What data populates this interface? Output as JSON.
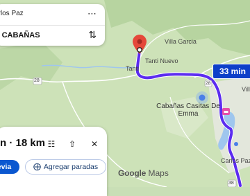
{
  "map": {
    "places": {
      "villa_garcia": "Villa Garcia",
      "tanti_nuevo": "Tanti Nuevo",
      "tanti": "Tanti",
      "cabanas_line1": "Cabañas Casitas De",
      "cabanas_line2": "Emma",
      "villa": "Villa",
      "carlos_paz": "Carlos Paz"
    },
    "route_shields": {
      "r28": "28",
      "r28_right": "28",
      "r38": "38"
    },
    "route_badge": "33 min",
    "route_color": "#5c2cf0",
    "attribution_brand": "Google",
    "attribution_product": "Maps"
  },
  "top_card": {
    "origin_label": "arlos Paz",
    "destination_label": "A CABAÑAS",
    "more_icon": "more-vert-icon",
    "swap_icon": "swap-vert-icon"
  },
  "bottom_card": {
    "eta_text": "n · 18 km",
    "preview_button": "evia",
    "add_stops_button": "Agregar paradas",
    "icons": [
      "tune-icon",
      "share-icon",
      "close-icon",
      "add-stop-icon"
    ]
  }
}
